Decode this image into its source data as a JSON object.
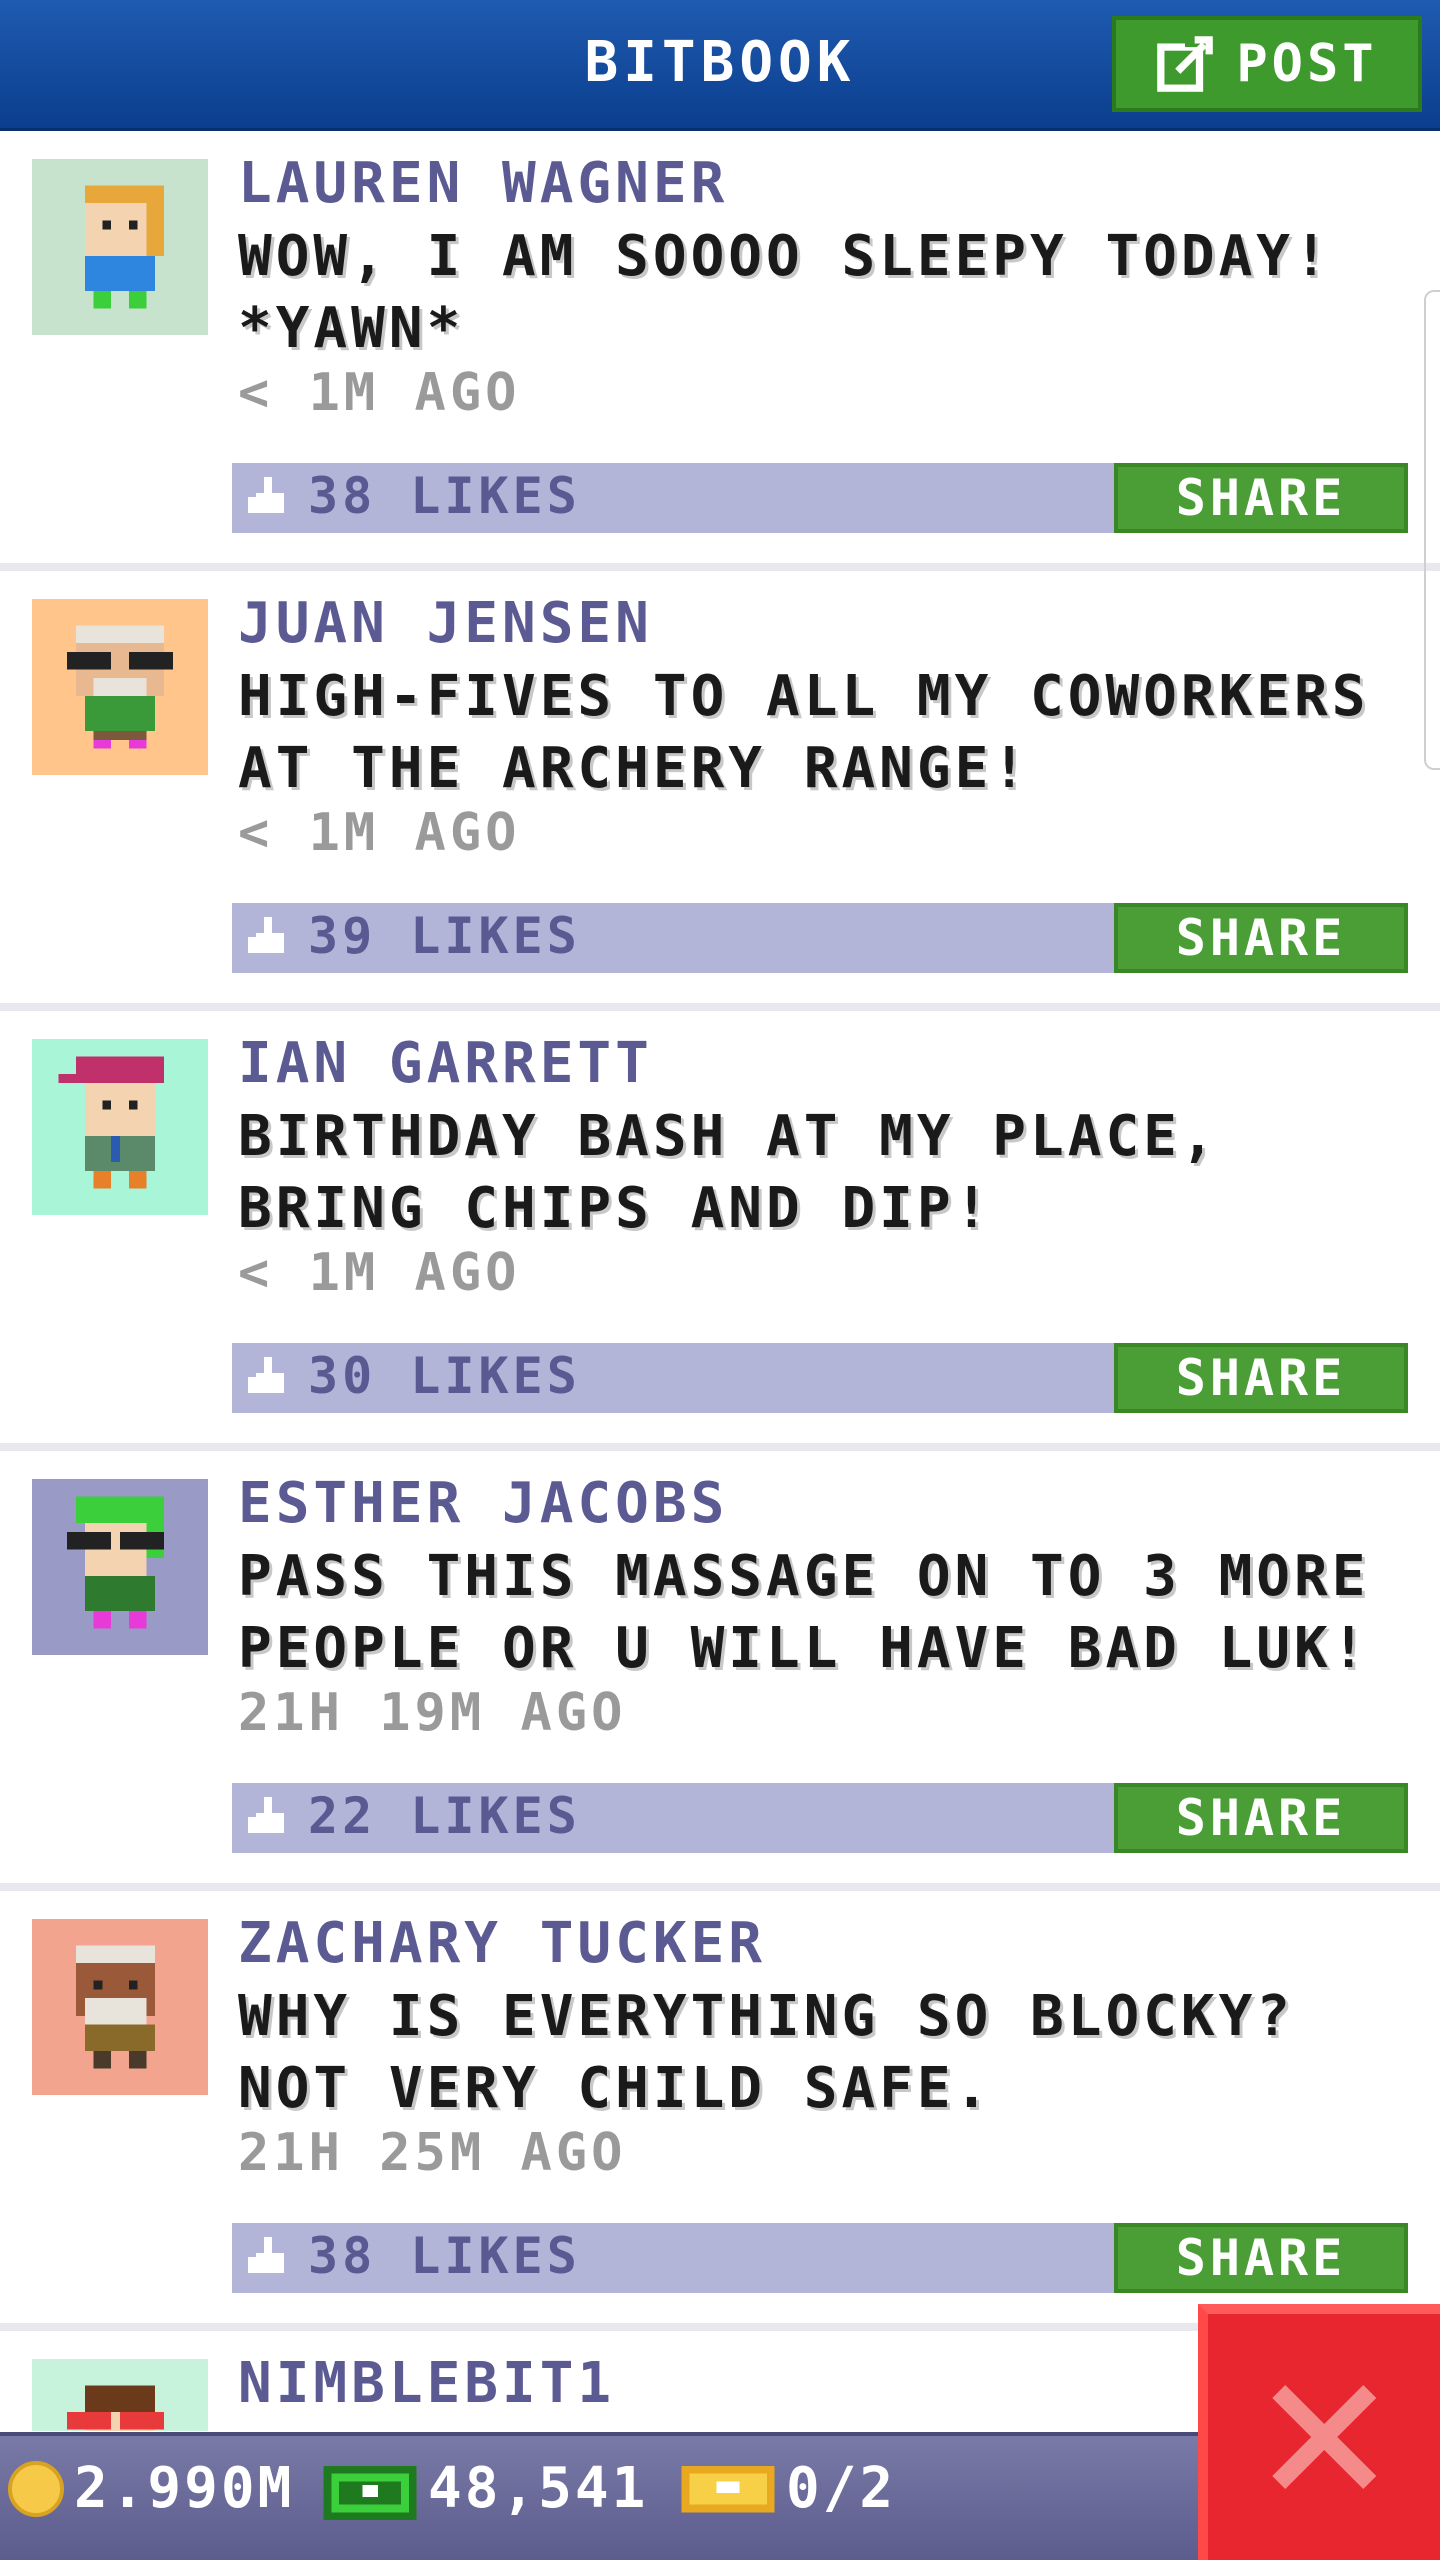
{
  "header": {
    "title": "BITBOOK",
    "post_label": "POST"
  },
  "posts": [
    {
      "author": "LAUREN WAGNER",
      "message": "WOW, I AM SOOOO SLEEPY TODAY! *YAWN*",
      "time": "< 1M AGO",
      "likes": "38 LIKES",
      "share": "SHARE",
      "avatar_bg": "#c7e3cd"
    },
    {
      "author": "JUAN JENSEN",
      "message": "HIGH-FIVES TO ALL MY COWORKERS AT THE ARCHERY RANGE!",
      "time": "< 1M AGO",
      "likes": "39 LIKES",
      "share": "SHARE",
      "avatar_bg": "#ffc58a"
    },
    {
      "author": "IAN GARRETT",
      "message": "BIRTHDAY BASH AT MY PLACE, BRING CHIPS AND DIP!",
      "time": "< 1M AGO",
      "likes": "30 LIKES",
      "share": "SHARE",
      "avatar_bg": "#a8f5d8"
    },
    {
      "author": "ESTHER JACOBS",
      "message": "PASS THIS MASSAGE ON TO 3 MORE PEOPLE OR U WILL HAVE BAD LUK!",
      "time": "21H 19M AGO",
      "likes": "22 LIKES",
      "share": "SHARE",
      "avatar_bg": "#9a9ac6"
    },
    {
      "author": "ZACHARY TUCKER",
      "message": "WHY IS EVERYTHING SO BLOCKY? NOT VERY CHILD SAFE.",
      "time": "21H 25M AGO",
      "likes": "38 LIKES",
      "share": "SHARE",
      "avatar_bg": "#f2a48e"
    },
    {
      "author": "NIMBLEBIT1",
      "avatar_bg": "#c7f3dc"
    }
  ],
  "footer": {
    "coins": "2.990M",
    "cash": "48,541",
    "tickets": "0/2"
  },
  "colors": {
    "header": "#0b3e8e",
    "post_button": "#3f9a2e",
    "share_button": "#4b9e35",
    "likes_bar": "#b2b4d8",
    "author": "#5b5a92",
    "close_button": "#e8262f"
  },
  "icons": [
    "edit-icon",
    "thumb-up-icon",
    "coin-icon",
    "cash-icon",
    "ticket-icon",
    "close-icon"
  ]
}
